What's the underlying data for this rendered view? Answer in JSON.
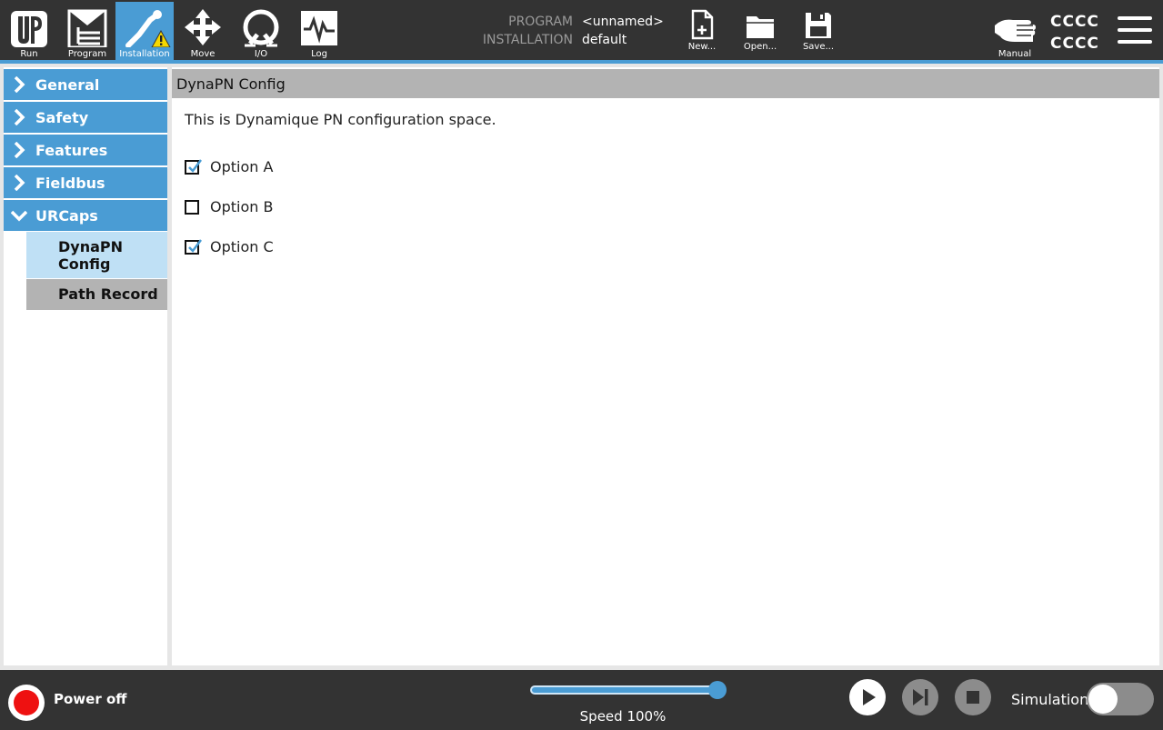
{
  "nav": {
    "items": [
      {
        "label": "Run",
        "icon": "ur-logo-icon"
      },
      {
        "label": "Program",
        "icon": "program-tree-icon"
      },
      {
        "label": "Installation",
        "icon": "robot-arm-warning-icon",
        "active": true
      },
      {
        "label": "Move",
        "icon": "move-arrows-icon"
      },
      {
        "label": "I/O",
        "icon": "io-icon"
      },
      {
        "label": "Log",
        "icon": "log-pulse-icon"
      }
    ]
  },
  "program": {
    "program_key": "PROGRAM",
    "program_value": "<unnamed>",
    "installation_key": "INSTALLATION",
    "installation_value": "default"
  },
  "file_actions": {
    "new_label": "New...",
    "open_label": "Open...",
    "save_label": "Save..."
  },
  "mode": {
    "label": "Manual",
    "icon": "hand-icon"
  },
  "user": {
    "line1": "CCCC",
    "line2": "CCCC"
  },
  "sidebar": {
    "items": [
      {
        "label": "General",
        "expanded": false
      },
      {
        "label": "Safety",
        "expanded": false
      },
      {
        "label": "Features",
        "expanded": false
      },
      {
        "label": "Fieldbus",
        "expanded": false
      },
      {
        "label": "URCaps",
        "expanded": true
      }
    ],
    "subitems": [
      {
        "label_line1": "DynaPN",
        "label_line2": "Config",
        "selected": true
      },
      {
        "label": "Path Record",
        "selected": false
      }
    ]
  },
  "content": {
    "title": "DynaPN Config",
    "description": "This is Dynamique PN configuration space.",
    "options": [
      {
        "label": "Option A",
        "checked": true
      },
      {
        "label": "Option B",
        "checked": false
      },
      {
        "label": "Option C",
        "checked": true
      }
    ]
  },
  "footer": {
    "power_label": "Power off",
    "speed_label": "Speed 100%",
    "speed_fraction": 1.0,
    "simulation_label": "Simulation",
    "simulation_on": false
  },
  "colors": {
    "header_bg": "#333333",
    "accent": "#4a9cd4",
    "selected_bg": "#bfe0f5",
    "power_red": "#ee1111"
  }
}
